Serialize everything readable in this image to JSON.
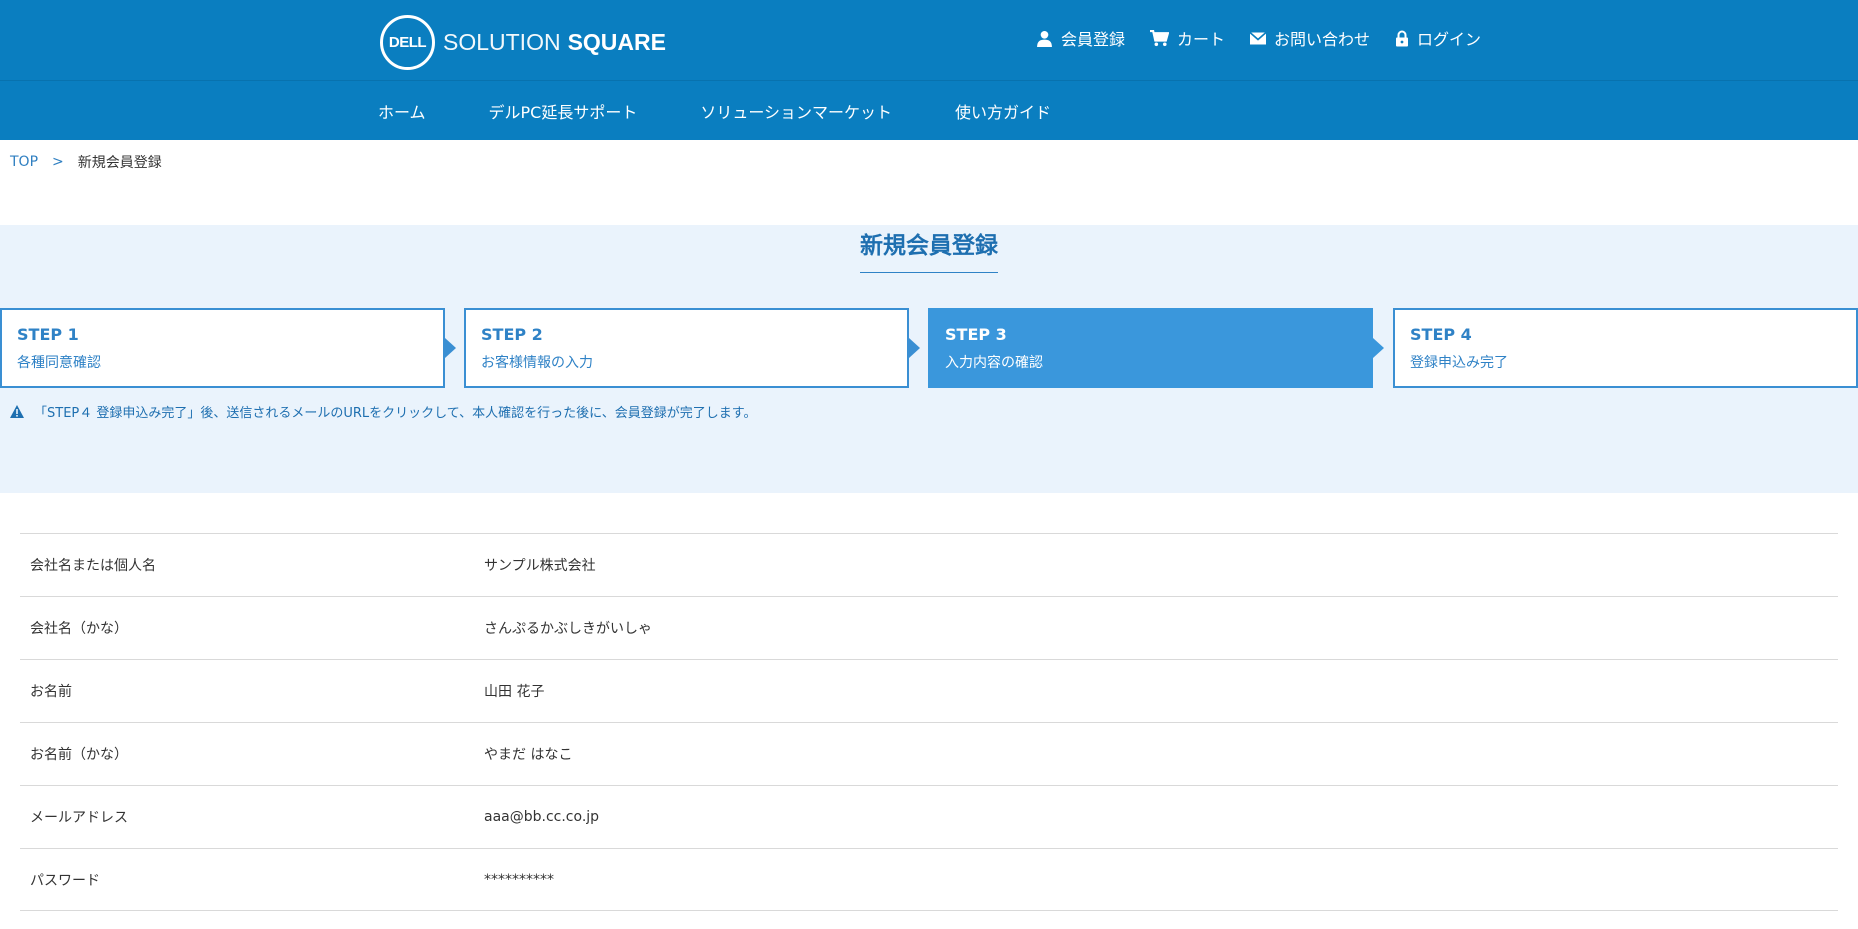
{
  "header": {
    "logo": {
      "mark": "DELL",
      "text_thin": "SOLUTION",
      "text_bold": "SQUARE"
    },
    "util": [
      {
        "label": "会員登録",
        "icon": "user-icon"
      },
      {
        "label": "カート",
        "icon": "cart-icon"
      },
      {
        "label": "お問い合わせ",
        "icon": "mail-icon"
      },
      {
        "label": "ログイン",
        "icon": "lock-icon"
      }
    ],
    "nav": [
      {
        "label": "ホーム"
      },
      {
        "label": "デルPC延長サポート"
      },
      {
        "label": "ソリューションマーケット"
      },
      {
        "label": "使い方ガイド"
      }
    ]
  },
  "breadcrumb": {
    "top": "TOP",
    "sep": ">",
    "current": "新規会員登録"
  },
  "page_title": "新規会員登録",
  "steps": [
    {
      "title": "STEP 1",
      "sub": "各種同意確認"
    },
    {
      "title": "STEP 2",
      "sub": "お客様情報の入力"
    },
    {
      "title": "STEP 3",
      "sub": "入力内容の確認"
    },
    {
      "title": "STEP 4",
      "sub": "登録申込み完了"
    }
  ],
  "notice": "「STEP４ 登録申込み完了」後、送信されるメールのURLをクリックして、本人確認を行った後に、会員登録が完了します。",
  "colors": {
    "header": "#0a7ec0",
    "accent": "#3a97dc",
    "band": "#eaf3fc"
  },
  "rows": [
    {
      "label": "会社名または個人名",
      "value": "サンプル株式会社"
    },
    {
      "label": "会社名（かな）",
      "value": "さんぷるかぶしきがいしゃ"
    },
    {
      "label": "お名前",
      "value": "山田 花子"
    },
    {
      "label": "お名前（かな）",
      "value": "やまだ はなこ"
    },
    {
      "label": "メールアドレス",
      "value": "aaa@bb.cc.co.jp"
    },
    {
      "label": "パスワード",
      "value": "**********"
    }
  ]
}
